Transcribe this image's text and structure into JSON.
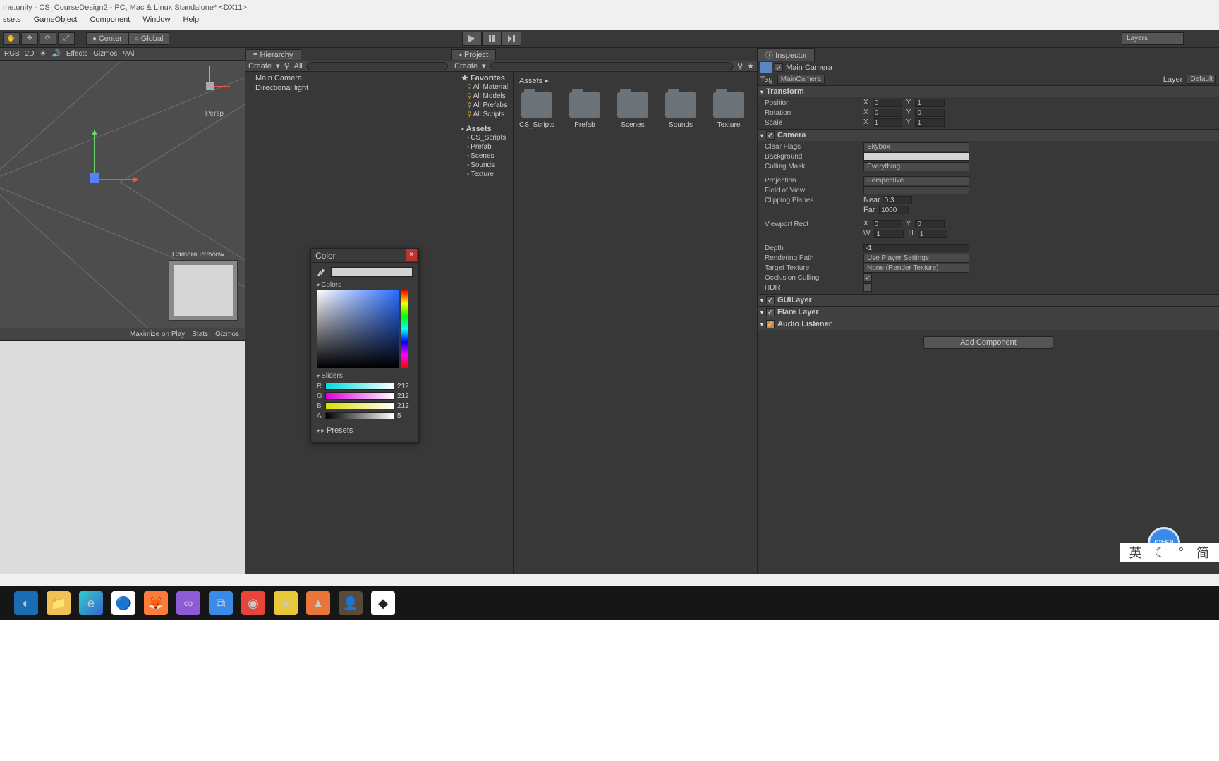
{
  "title": "me.unity - CS_CourseDesign2 - PC, Mac & Linux Standalone* <DX11>",
  "menu": [
    "ssets",
    "GameObject",
    "Component",
    "Window",
    "Help"
  ],
  "toolbar": {
    "center": "Center",
    "global": "Global",
    "layers": "Layers"
  },
  "scene": {
    "rgb": "RGB",
    "mode": "2D",
    "effects": "Effects",
    "gizmos": "Gizmos",
    "all": "All",
    "persp": "Persp",
    "camprev": "Camera Preview"
  },
  "game": {
    "max": "Maximize on Play",
    "stats": "Stats",
    "gizmos": "Gizmos"
  },
  "hierarchy": {
    "title": "Hierarchy",
    "create": "Create",
    "all": "All",
    "items": [
      "Main Camera",
      "Directional light"
    ]
  },
  "project": {
    "title": "Project",
    "create": "Create",
    "favorites": "Favorites",
    "fav": [
      "All Material",
      "All Models",
      "All Prefabs",
      "All Scripts"
    ],
    "assets": "Assets",
    "tree": [
      "CS_Scripts",
      "Prefab",
      "Scenes",
      "Sounds",
      "Texture"
    ],
    "crumb": "Assets ▸",
    "folders": [
      "CS_Scripts",
      "Prefab",
      "Scenes",
      "Sounds",
      "Texture"
    ]
  },
  "inspector": {
    "title": "Inspector",
    "name": "Main Camera",
    "tag": "Tag",
    "tagv": "MainCamera",
    "layer": "Layer",
    "layerv": "Default",
    "transform": "Transform",
    "position": "Position",
    "rotation": "Rotation",
    "scale": "Scale",
    "pos": {
      "x": "0",
      "y": "1"
    },
    "rot": {
      "x": "0",
      "y": "0"
    },
    "scl": {
      "x": "1",
      "y": "1"
    },
    "camera": "Camera",
    "clearflags": "Clear Flags",
    "clearflagsv": "Skybox",
    "background": "Background",
    "cullmask": "Culling Mask",
    "cullmaskv": "Everything",
    "projection": "Projection",
    "projectionv": "Perspective",
    "fov": "Field of View",
    "clip": "Clipping Planes",
    "near": "Near",
    "nearv": "0.3",
    "far": "Far",
    "farv": "1000",
    "viewrect": "Viewport Rect",
    "vx": "0",
    "vy": "0",
    "vw": "1",
    "vh": "1",
    "depth": "Depth",
    "depthv": "-1",
    "rpath": "Rendering Path",
    "rpathv": "Use Player Settings",
    "ttex": "Target Texture",
    "ttexv": "None (Render Texture)",
    "occ": "Occlusion Culling",
    "hdr": "HDR",
    "gui": "GUILayer",
    "flare": "Flare Layer",
    "audio": "Audio Listener",
    "addcomp": "Add Component"
  },
  "color": {
    "title": "Color",
    "colors": "Colors",
    "sliders": "Sliders",
    "presets": "Presets",
    "r": "R",
    "g": "G",
    "b": "B",
    "a": "A",
    "rv": "212",
    "gv": "212",
    "bv": "212",
    "av": "5"
  },
  "timer": "02:58",
  "ime": [
    "英",
    "☾",
    "",
    "简"
  ]
}
